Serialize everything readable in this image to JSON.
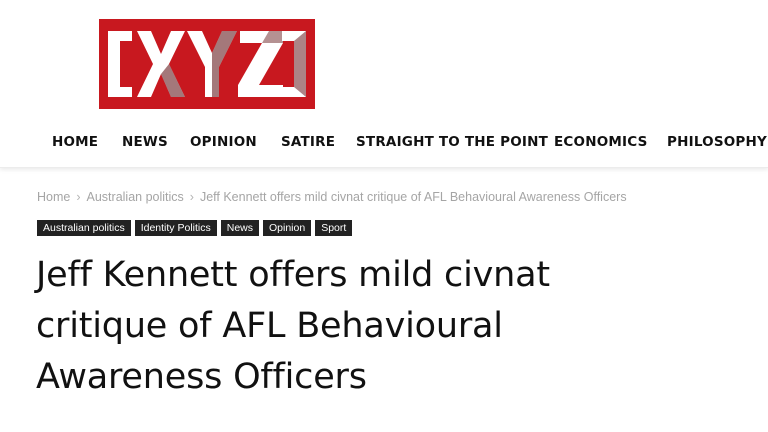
{
  "logo": {
    "text": "XYZ",
    "colors": {
      "background": "#c8181f",
      "letters": "#ffffff",
      "shadow": "#5a0a0d"
    }
  },
  "nav": {
    "items": [
      {
        "label": "HOME"
      },
      {
        "label": "NEWS"
      },
      {
        "label": "OPINION"
      },
      {
        "label": "SATIRE"
      },
      {
        "label": "STRAIGHT TO THE POINT"
      },
      {
        "label": "ECONOMICS"
      },
      {
        "label": "PHILOSOPHY"
      }
    ]
  },
  "breadcrumb": {
    "items": [
      "Home",
      "Australian politics",
      "Jeff Kennett offers mild civnat critique of AFL Behavioural Awareness Officers"
    ],
    "separator": "›"
  },
  "tags": [
    "Australian politics",
    "Identity Politics",
    "News",
    "Opinion",
    "Sport"
  ],
  "article": {
    "title": "Jeff Kennett offers mild civnat critique of AFL Behavioural Awareness Officers"
  },
  "colors": {
    "tag_background": "#222222",
    "breadcrumb_text": "#a5a5a5",
    "title_text": "#111111"
  }
}
